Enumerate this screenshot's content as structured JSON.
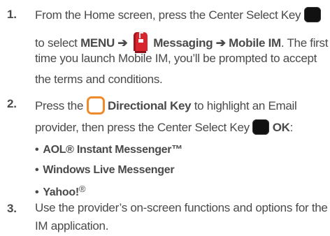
{
  "steps": [
    {
      "number": "1.",
      "lines": {
        "l1_a": "From the Home screen, press the Center Select Key",
        "l2_a": "to select",
        "l2_menu": "MENU",
        "l2_arrow1": "➔",
        "l2_messaging": "Messaging",
        "l2_arrow2": "➔",
        "l2_mobileim": "Mobile IM",
        "l2_b": ". The first",
        "l3": "time you launch Mobile IM, you’ll be prompted to accept",
        "l4": "the terms and conditions."
      }
    },
    {
      "number": "2.",
      "lines": {
        "l1_a": "Press the",
        "l1_key": "Directional Key",
        "l1_b": "to highlight an Email",
        "l2_a": "provider, then press the Center Select Key",
        "l2_ok": "OK",
        "l2_colon": ":"
      },
      "bullets": [
        {
          "text": "AOL® Instant Messenger™",
          "sup": ""
        },
        {
          "text": "Windows Live Messenger",
          "sup": ""
        },
        {
          "text": "Yahoo!",
          "sup": "®"
        }
      ]
    },
    {
      "number": "3.",
      "lines": {
        "l1": "Use the provider’s on-screen functions and options for the",
        "l2": "IM application."
      }
    }
  ],
  "bullet_char": "•",
  "icons": {
    "center_select_key": "center-select-key-icon",
    "directional_key": "directional-key-icon",
    "messaging": "messaging-mailbox-icon"
  },
  "colors": {
    "text": "#4a4a4a",
    "key_black": "#111111",
    "key_orange": "#f08a2a",
    "mailbox_red": "#d8262f"
  }
}
